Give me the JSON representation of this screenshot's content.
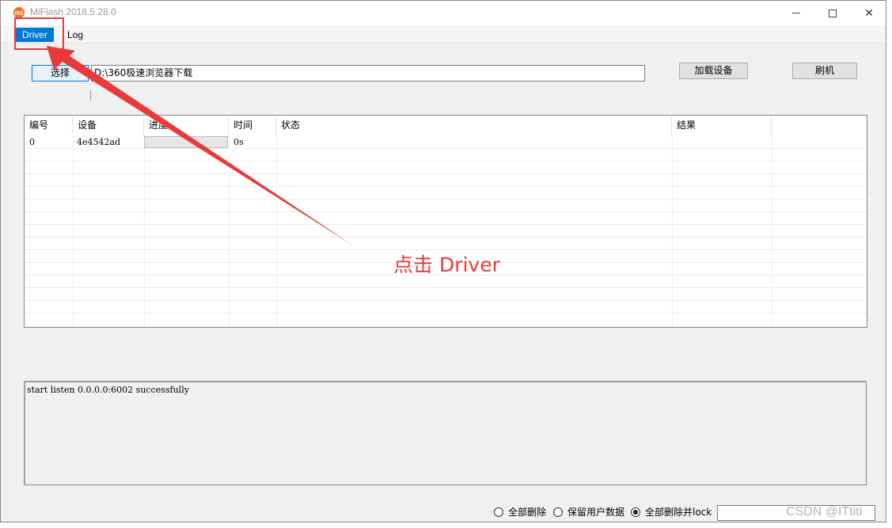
{
  "window": {
    "title": "MiFlash 2018.5.28.0",
    "logo_glyph": "mi",
    "close_glyph": "✕"
  },
  "menu": {
    "driver": "Driver",
    "log": "Log"
  },
  "toolbar": {
    "select_label": "选择",
    "path_value": "D:\\360极速浏览器下载",
    "load_device_label": "加载设备",
    "flash_label": "刷机"
  },
  "table": {
    "headers": [
      "编号",
      "设备",
      "进度",
      "时间",
      "状态",
      "结果"
    ],
    "rows": [
      {
        "id": "0",
        "device": "4e4542ad",
        "progress": 0,
        "time": "0s",
        "status": "",
        "result": ""
      }
    ]
  },
  "log": {
    "text": "start listen 0.0.0.0:6002 successfully"
  },
  "options": {
    "clean_all": "全部删除",
    "save_user_data": "保留用户数据",
    "clean_all_and_lock": "全部删除并lock",
    "selected": "clean_all_and_lock"
  },
  "annotation": {
    "text": "点击 Driver",
    "color": "#e83a3a"
  },
  "watermark": "CSDN @ITtiti"
}
